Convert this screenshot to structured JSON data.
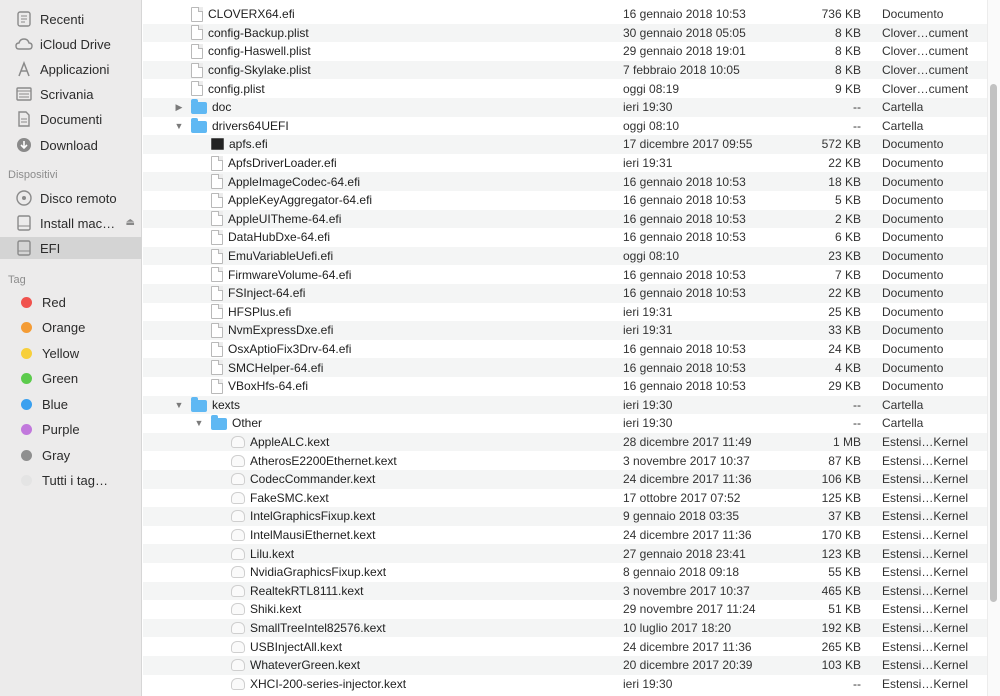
{
  "sidebar": {
    "favorites": [
      {
        "label": "Recenti",
        "icon": "clock-icon"
      },
      {
        "label": "iCloud Drive",
        "icon": "cloud-icon"
      },
      {
        "label": "Applicazioni",
        "icon": "applications-icon"
      },
      {
        "label": "Scrivania",
        "icon": "desktop-icon"
      },
      {
        "label": "Documenti",
        "icon": "documents-icon"
      },
      {
        "label": "Download",
        "icon": "download-icon"
      }
    ],
    "devices_header": "Dispositivi",
    "devices": [
      {
        "label": "Disco remoto",
        "icon": "remote-disc-icon"
      },
      {
        "label": "Install mac…",
        "icon": "drive-icon",
        "eject": true
      },
      {
        "label": "EFI",
        "icon": "drive-icon",
        "selected": true
      }
    ],
    "tags_header": "Tag",
    "tags": [
      {
        "label": "Red",
        "color": "#f0524d"
      },
      {
        "label": "Orange",
        "color": "#f49c35"
      },
      {
        "label": "Yellow",
        "color": "#f7cf3b"
      },
      {
        "label": "Green",
        "color": "#5ccb4c"
      },
      {
        "label": "Blue",
        "color": "#3aa0ef"
      },
      {
        "label": "Purple",
        "color": "#c178dc"
      },
      {
        "label": "Gray",
        "color": "#8f8f8f"
      },
      {
        "label": "Tutti i tag…",
        "color": "#e4e4e4"
      }
    ]
  },
  "files": [
    {
      "name": "CLOVERX64.efi",
      "date": "16 gennaio 2018 10:53",
      "size": "736 KB",
      "kind": "Documento",
      "level": 0,
      "type": "doc"
    },
    {
      "name": "config-Backup.plist",
      "date": "30 gennaio 2018 05:05",
      "size": "8 KB",
      "kind": "Clover…cument",
      "level": 0,
      "type": "doc"
    },
    {
      "name": "config-Haswell.plist",
      "date": "29 gennaio 2018 19:01",
      "size": "8 KB",
      "kind": "Clover…cument",
      "level": 0,
      "type": "doc"
    },
    {
      "name": "config-Skylake.plist",
      "date": "7 febbraio 2018 10:05",
      "size": "8 KB",
      "kind": "Clover…cument",
      "level": 0,
      "type": "doc"
    },
    {
      "name": "config.plist",
      "date": "oggi 08:19",
      "size": "9 KB",
      "kind": "Clover…cument",
      "level": 0,
      "type": "doc"
    },
    {
      "name": "doc",
      "date": "ieri 19:30",
      "size": "--",
      "kind": "Cartella",
      "level": 0,
      "type": "folder",
      "disclosure": "closed"
    },
    {
      "name": "drivers64UEFI",
      "date": "oggi 08:10",
      "size": "--",
      "kind": "Cartella",
      "level": 0,
      "type": "folder",
      "disclosure": "open"
    },
    {
      "name": "apfs.efi",
      "date": "17 dicembre 2017 09:55",
      "size": "572 KB",
      "kind": "Documento",
      "level": 1,
      "type": "exec"
    },
    {
      "name": "ApfsDriverLoader.efi",
      "date": "ieri 19:31",
      "size": "22 KB",
      "kind": "Documento",
      "level": 1,
      "type": "doc"
    },
    {
      "name": "AppleImageCodec-64.efi",
      "date": "16 gennaio 2018 10:53",
      "size": "18 KB",
      "kind": "Documento",
      "level": 1,
      "type": "doc"
    },
    {
      "name": "AppleKeyAggregator-64.efi",
      "date": "16 gennaio 2018 10:53",
      "size": "5 KB",
      "kind": "Documento",
      "level": 1,
      "type": "doc"
    },
    {
      "name": "AppleUITheme-64.efi",
      "date": "16 gennaio 2018 10:53",
      "size": "2 KB",
      "kind": "Documento",
      "level": 1,
      "type": "doc"
    },
    {
      "name": "DataHubDxe-64.efi",
      "date": "16 gennaio 2018 10:53",
      "size": "6 KB",
      "kind": "Documento",
      "level": 1,
      "type": "doc"
    },
    {
      "name": "EmuVariableUefi.efi",
      "date": "oggi 08:10",
      "size": "23 KB",
      "kind": "Documento",
      "level": 1,
      "type": "doc"
    },
    {
      "name": "FirmwareVolume-64.efi",
      "date": "16 gennaio 2018 10:53",
      "size": "7 KB",
      "kind": "Documento",
      "level": 1,
      "type": "doc"
    },
    {
      "name": "FSInject-64.efi",
      "date": "16 gennaio 2018 10:53",
      "size": "22 KB",
      "kind": "Documento",
      "level": 1,
      "type": "doc"
    },
    {
      "name": "HFSPlus.efi",
      "date": "ieri 19:31",
      "size": "25 KB",
      "kind": "Documento",
      "level": 1,
      "type": "doc"
    },
    {
      "name": "NvmExpressDxe.efi",
      "date": "ieri 19:31",
      "size": "33 KB",
      "kind": "Documento",
      "level": 1,
      "type": "doc"
    },
    {
      "name": "OsxAptioFix3Drv-64.efi",
      "date": "16 gennaio 2018 10:53",
      "size": "24 KB",
      "kind": "Documento",
      "level": 1,
      "type": "doc"
    },
    {
      "name": "SMCHelper-64.efi",
      "date": "16 gennaio 2018 10:53",
      "size": "4 KB",
      "kind": "Documento",
      "level": 1,
      "type": "doc"
    },
    {
      "name": "VBoxHfs-64.efi",
      "date": "16 gennaio 2018 10:53",
      "size": "29 KB",
      "kind": "Documento",
      "level": 1,
      "type": "doc"
    },
    {
      "name": "kexts",
      "date": "ieri 19:30",
      "size": "--",
      "kind": "Cartella",
      "level": 0,
      "type": "folder",
      "disclosure": "open"
    },
    {
      "name": "Other",
      "date": "ieri 19:30",
      "size": "--",
      "kind": "Cartella",
      "level": 1,
      "type": "folder",
      "disclosure": "open"
    },
    {
      "name": "AppleALC.kext",
      "date": "28 dicembre 2017 11:49",
      "size": "1 MB",
      "kind": "Estensi…Kernel",
      "level": 2,
      "type": "kext"
    },
    {
      "name": "AtherosE2200Ethernet.kext",
      "date": "3 novembre 2017 10:37",
      "size": "87 KB",
      "kind": "Estensi…Kernel",
      "level": 2,
      "type": "kext"
    },
    {
      "name": "CodecCommander.kext",
      "date": "24 dicembre 2017 11:36",
      "size": "106 KB",
      "kind": "Estensi…Kernel",
      "level": 2,
      "type": "kext"
    },
    {
      "name": "FakeSMC.kext",
      "date": "17 ottobre 2017 07:52",
      "size": "125 KB",
      "kind": "Estensi…Kernel",
      "level": 2,
      "type": "kext"
    },
    {
      "name": "IntelGraphicsFixup.kext",
      "date": "9 gennaio 2018 03:35",
      "size": "37 KB",
      "kind": "Estensi…Kernel",
      "level": 2,
      "type": "kext"
    },
    {
      "name": "IntelMausiEthernet.kext",
      "date": "24 dicembre 2017 11:36",
      "size": "170 KB",
      "kind": "Estensi…Kernel",
      "level": 2,
      "type": "kext"
    },
    {
      "name": "Lilu.kext",
      "date": "27 gennaio 2018 23:41",
      "size": "123 KB",
      "kind": "Estensi…Kernel",
      "level": 2,
      "type": "kext"
    },
    {
      "name": "NvidiaGraphicsFixup.kext",
      "date": "8 gennaio 2018 09:18",
      "size": "55 KB",
      "kind": "Estensi…Kernel",
      "level": 2,
      "type": "kext"
    },
    {
      "name": "RealtekRTL8111.kext",
      "date": "3 novembre 2017 10:37",
      "size": "465 KB",
      "kind": "Estensi…Kernel",
      "level": 2,
      "type": "kext"
    },
    {
      "name": "Shiki.kext",
      "date": "29 novembre 2017 11:24",
      "size": "51 KB",
      "kind": "Estensi…Kernel",
      "level": 2,
      "type": "kext"
    },
    {
      "name": "SmallTreeIntel82576.kext",
      "date": "10 luglio 2017 18:20",
      "size": "192 KB",
      "kind": "Estensi…Kernel",
      "level": 2,
      "type": "kext"
    },
    {
      "name": "USBInjectAll.kext",
      "date": "24 dicembre 2017 11:36",
      "size": "265 KB",
      "kind": "Estensi…Kernel",
      "level": 2,
      "type": "kext"
    },
    {
      "name": "WhateverGreen.kext",
      "date": "20 dicembre 2017 20:39",
      "size": "103 KB",
      "kind": "Estensi…Kernel",
      "level": 2,
      "type": "kext"
    },
    {
      "name": "XHCI-200-series-injector.kext",
      "date": "ieri 19:30",
      "size": "--",
      "kind": "Estensi…Kernel",
      "level": 2,
      "type": "kext"
    }
  ]
}
